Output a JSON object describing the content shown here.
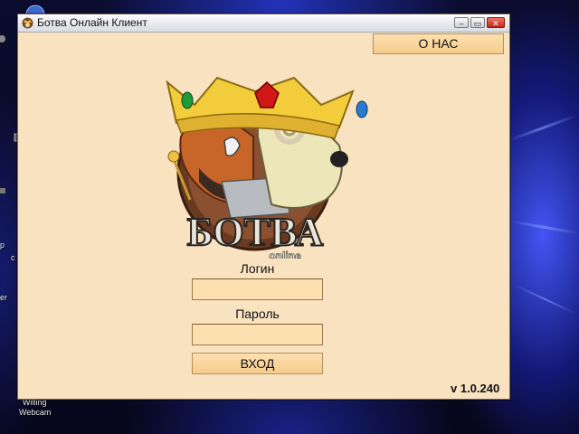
{
  "desktop": {
    "icon_label_line1": "Willing",
    "icon_label_line2": "Webcam",
    "edge_letters": [
      "p",
      "c",
      "er"
    ]
  },
  "window": {
    "title": "Ботва Онлайн Клиент",
    "controls": {
      "minimize": "–",
      "maximize": "▭",
      "close": "✕"
    },
    "about_label": "О НАС",
    "logo_text": "БОТВА",
    "logo_subtext": "online",
    "login_label": "Логин",
    "login_value": "",
    "password_label": "Пароль",
    "password_value": "",
    "login_button_label": "ВХОД",
    "version": "v 1.0.240"
  },
  "icons": {
    "app": "botva-app-icon",
    "logo": "botva-crown-logo"
  },
  "colors": {
    "window_bg": "#f8e2c0",
    "button_bg": "#f6cc8c",
    "field_bg": "#fde0b0",
    "desktop_glow": "#4a5aff"
  }
}
